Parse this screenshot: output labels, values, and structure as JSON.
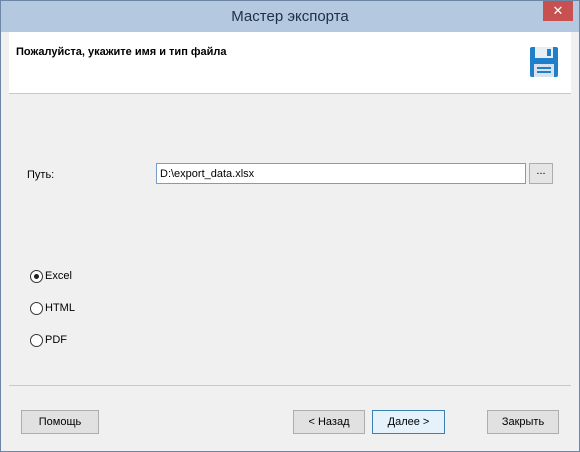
{
  "window": {
    "title": "Мастер экспорта",
    "close_label": "✕"
  },
  "header": {
    "title": "Пожалуйста, укажите имя и тип файла",
    "icon": "floppy-disk-icon"
  },
  "path": {
    "label": "Путь:",
    "value": "D:\\export_data.xlsx",
    "browse_label": "..."
  },
  "formats": [
    {
      "label": "Excel",
      "selected": true
    },
    {
      "label": "HTML",
      "selected": false
    },
    {
      "label": "PDF",
      "selected": false
    }
  ],
  "buttons": {
    "help": "Помощь",
    "back": "< Назад",
    "next": "Далее >",
    "close": "Закрыть"
  },
  "colors": {
    "title_bar": "#b4c8e0",
    "close_button": "#c75050",
    "icon_blue": "#1f7fc8"
  }
}
